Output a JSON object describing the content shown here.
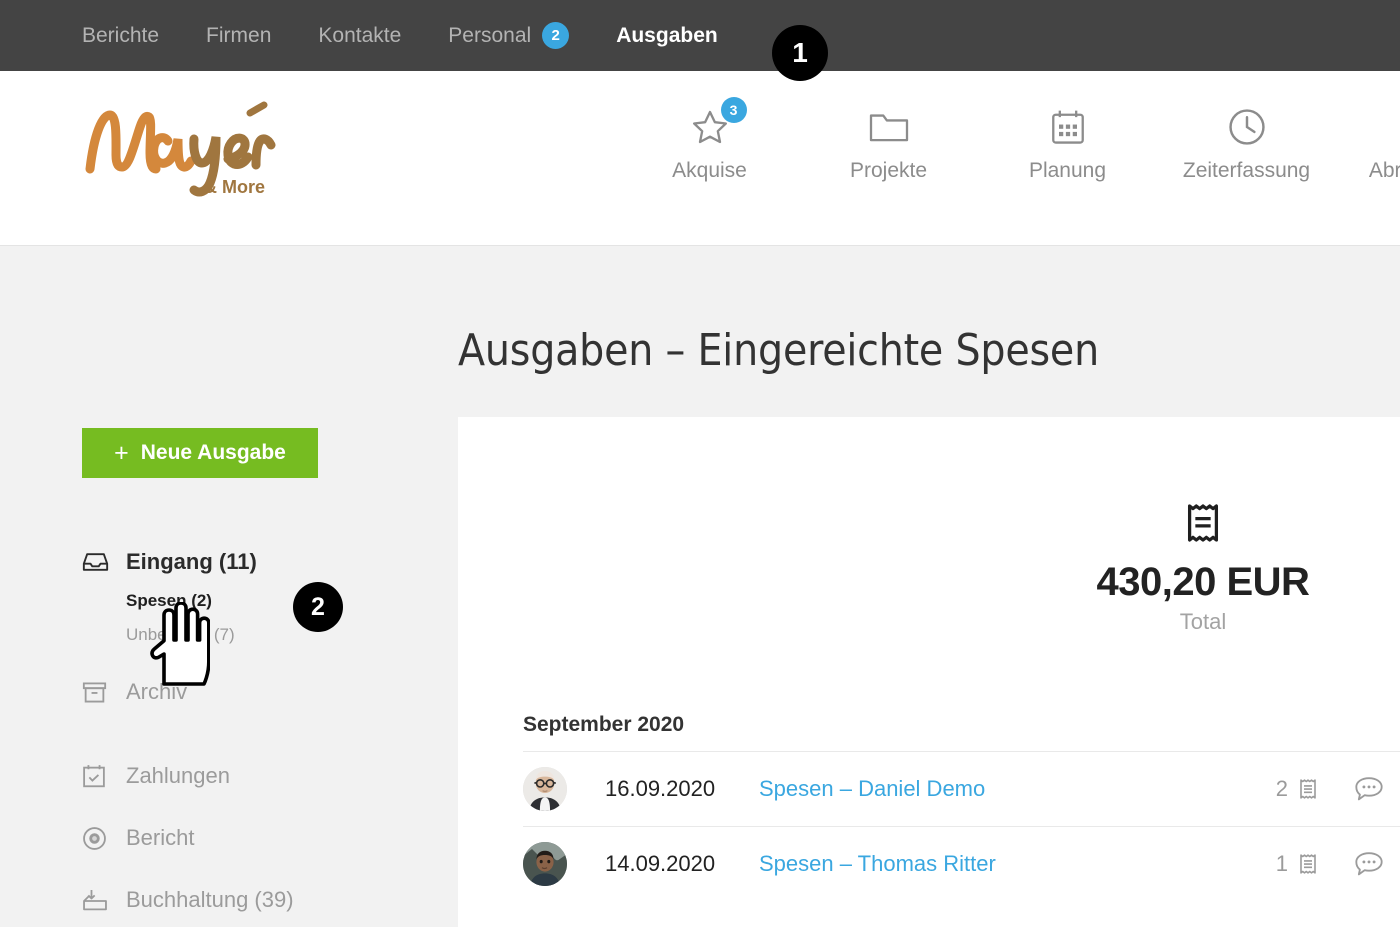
{
  "topbar": {
    "items": [
      {
        "label": "Berichte",
        "active": false,
        "badge": null
      },
      {
        "label": "Firmen",
        "active": false,
        "badge": null
      },
      {
        "label": "Kontakte",
        "active": false,
        "badge": null
      },
      {
        "label": "Personal",
        "active": false,
        "badge": "2"
      },
      {
        "label": "Ausgaben",
        "active": true,
        "badge": null
      }
    ]
  },
  "brand": {
    "name": "Mayér",
    "tagline": "& More",
    "color_primary": "#d4883c",
    "color_secondary": "#a0763f"
  },
  "mainnav": {
    "items": [
      {
        "label": "Akquise",
        "icon": "star-icon",
        "badge": "3"
      },
      {
        "label": "Projekte",
        "icon": "folder-icon",
        "badge": null
      },
      {
        "label": "Planung",
        "icon": "calendar-icon",
        "badge": null
      },
      {
        "label": "Zeiterfassung",
        "icon": "clock-icon",
        "badge": null
      },
      {
        "label": "Abrechnung",
        "icon": "invoice-icon",
        "badge": null
      }
    ]
  },
  "page": {
    "title": "Ausgaben – Eingereichte Spesen"
  },
  "sidebar": {
    "new_button": {
      "label": "Neue Ausgabe",
      "plus": "+",
      "color": "#76bc21"
    },
    "inbox": {
      "label": "Eingang (11)",
      "icon": "inbox-icon"
    },
    "sub_items": [
      {
        "label": "Spesen (2)",
        "active": true
      },
      {
        "label": "Unbemerkt (7)",
        "active": false
      }
    ],
    "items": [
      {
        "label": "Archiv",
        "icon": "archive-icon"
      },
      {
        "label": "Zahlungen",
        "icon": "calendar-check-icon"
      },
      {
        "label": "Bericht",
        "icon": "report-eye-icon"
      },
      {
        "label": "Buchhaltung (39)",
        "icon": "accounting-tray-icon"
      }
    ]
  },
  "summary": {
    "icon": "receipt-icon",
    "amount": "430,20 EUR",
    "label": "Total"
  },
  "list": {
    "month_heading": "September 2020",
    "rows": [
      {
        "date": "16.09.2020",
        "title": "Spesen – Daniel Demo",
        "receipt_count": "2",
        "receipt_icon": "receipt-icon",
        "comment_icon": "comment-icon",
        "avatar": "avatar-daniel-demo"
      },
      {
        "date": "14.09.2020",
        "title": "Spesen – Thomas Ritter",
        "receipt_count": "1",
        "receipt_icon": "receipt-icon",
        "comment_icon": "comment-icon",
        "avatar": "avatar-thomas-ritter"
      }
    ]
  },
  "markers": [
    {
      "label": "1"
    },
    {
      "label": "2"
    }
  ],
  "colors": {
    "topbar_bg": "#444444",
    "accent_blue": "#3aa7e0",
    "accent_green": "#76bc21",
    "page_bg": "#f2f2f2"
  }
}
